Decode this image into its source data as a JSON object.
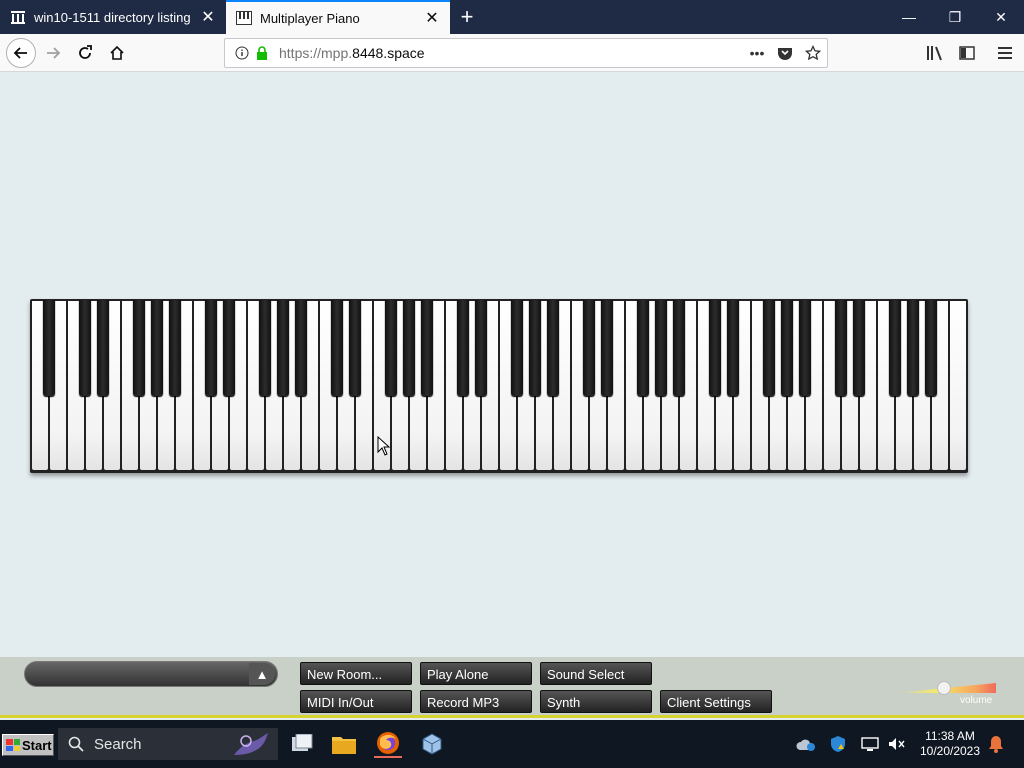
{
  "browser": {
    "tabs": [
      {
        "title": "win10-1511 directory listing",
        "active": false
      },
      {
        "title": "Multiplayer Piano",
        "active": true
      }
    ],
    "url_prefix": "https://mpp.",
    "url_domain": "8448.space"
  },
  "piano": {
    "white_key_count": 52,
    "black_key_count": 36
  },
  "controls": {
    "row1": [
      "New Room...",
      "Play Alone",
      "Sound Select"
    ],
    "row2": [
      "MIDI In/Out",
      "Record MP3",
      "Synth",
      "Client Settings"
    ],
    "volume_label": "volume",
    "volume_level": 0.48
  },
  "taskbar": {
    "start_label": "Start",
    "search_placeholder": "Search",
    "time": "11:38 AM",
    "date": "10/20/2023"
  }
}
